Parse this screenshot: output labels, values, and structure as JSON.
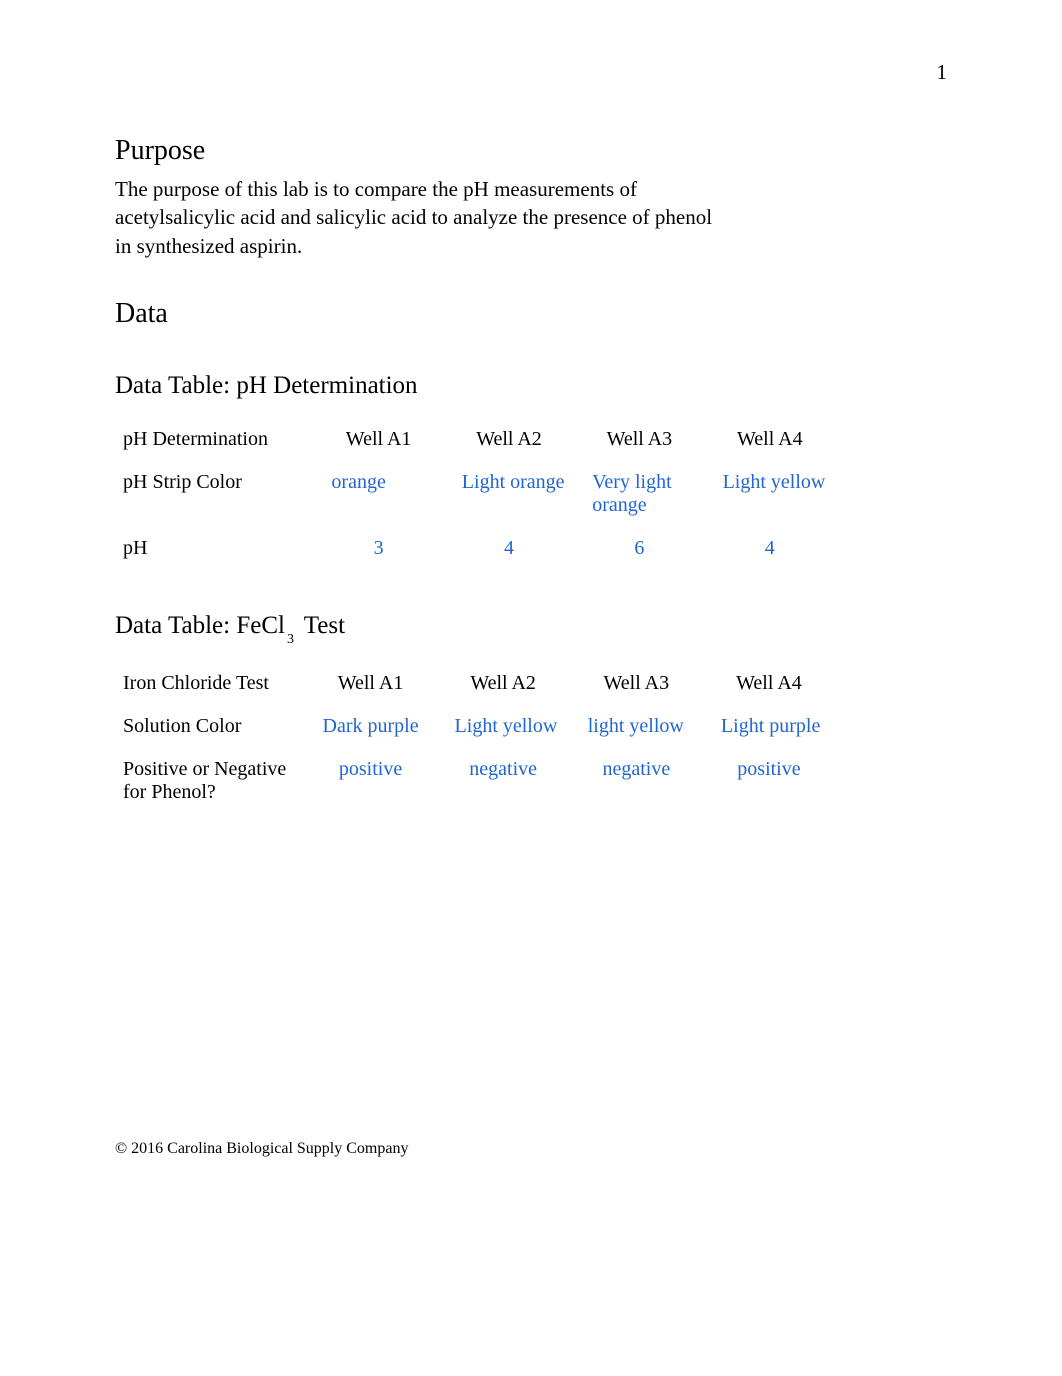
{
  "page_number": "1",
  "purpose": {
    "heading": "Purpose",
    "text": "The purpose of this lab is to compare the pH measurements of acetylsalicylic acid and salicylic acid to analyze the presence of phenol in synthesized aspirin."
  },
  "data_heading": "Data",
  "table1": {
    "title": "Data Table: pH Determination",
    "headers": [
      "pH Determination",
      "Well A1",
      "Well A2",
      "Well A3",
      "Well A4"
    ],
    "rows": [
      {
        "label": "pH Strip Color",
        "cells": [
          "orange",
          "Light orange",
          "Very light orange",
          "Light yellow"
        ]
      },
      {
        "label": "pH",
        "cells": [
          "3",
          "4",
          "6",
          "4"
        ]
      }
    ]
  },
  "table2": {
    "title_prefix": "Data Table: FeCl",
    "title_sub": "3",
    "title_suffix": " Test",
    "headers": [
      "Iron Chloride Test",
      "Well A1",
      "Well A2",
      "Well A3",
      "Well A4"
    ],
    "rows": [
      {
        "label": "Solution Color",
        "cells": [
          "Dark purple",
          "Light yellow",
          "light yellow",
          "Light purple"
        ]
      },
      {
        "label": "Positive or Negative for Phenol?",
        "cells": [
          "positive",
          "negative",
          "negative",
          "positive"
        ]
      }
    ]
  },
  "copyright": "© 2016 Carolina Biological Supply Company",
  "chart_data": [
    {
      "type": "table",
      "title": "pH Determination",
      "columns": [
        "Well A1",
        "Well A2",
        "Well A3",
        "Well A4"
      ],
      "rows": [
        {
          "metric": "pH Strip Color",
          "values": [
            "orange",
            "Light orange",
            "Very light orange",
            "Light yellow"
          ]
        },
        {
          "metric": "pH",
          "values": [
            3,
            4,
            6,
            4
          ]
        }
      ]
    },
    {
      "type": "table",
      "title": "FeCl3 Test",
      "columns": [
        "Well A1",
        "Well A2",
        "Well A3",
        "Well A4"
      ],
      "rows": [
        {
          "metric": "Solution Color",
          "values": [
            "Dark purple",
            "Light yellow",
            "light yellow",
            "Light purple"
          ]
        },
        {
          "metric": "Positive or Negative for Phenol?",
          "values": [
            "positive",
            "negative",
            "negative",
            "positive"
          ]
        }
      ]
    }
  ]
}
